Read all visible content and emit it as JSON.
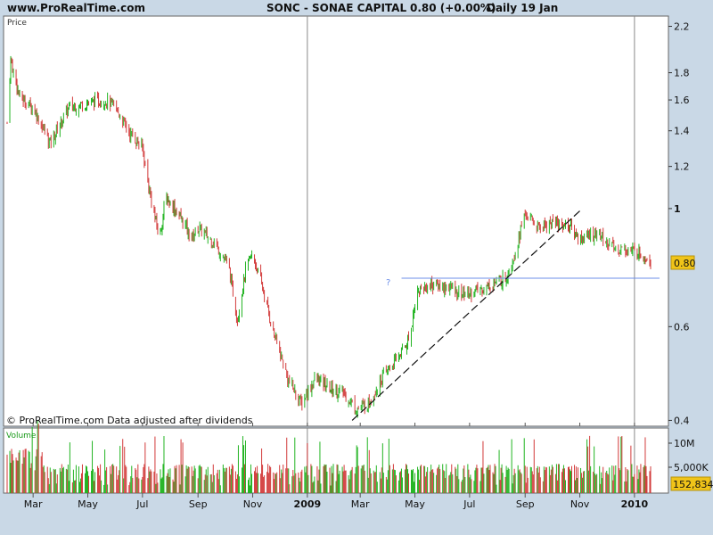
{
  "header": {
    "site": "www.ProRealTime.com",
    "title": "SONC - SONAE CAPITAL",
    "quote": "0.80 (+0.00%)",
    "period": "Daily  19 Jan"
  },
  "price_panel": {
    "label": "Price",
    "copyright": "© ProRealTime.com  Data adjusted after dividends",
    "last_price_badge": "0.80",
    "annotation": "?"
  },
  "volume_panel": {
    "label": "Volume",
    "last_volume_badge": "152,834"
  },
  "colors": {
    "up": "#22b422",
    "down": "#d23a3a",
    "badge": "#f0c419",
    "support_line": "#6d8fe8",
    "trendline": "#111111"
  },
  "chart_data": [
    {
      "type": "candlestick",
      "title": "SONC - SONAE CAPITAL",
      "ylabel": "Price",
      "y_scale": "log",
      "ylim": [
        0.39,
        2.3
      ],
      "y_ticks": [
        "2.2",
        "1.8",
        "1.6",
        "1.4",
        "1.2",
        "1",
        "0.6",
        "0.4"
      ],
      "x_range": [
        "2008-02-01",
        "2010-01-19"
      ],
      "x_ticks": [
        {
          "label": "Mar",
          "date": "2008-03-01"
        },
        {
          "label": "May",
          "date": "2008-05-01"
        },
        {
          "label": "Jul",
          "date": "2008-07-01"
        },
        {
          "label": "Sep",
          "date": "2008-09-01"
        },
        {
          "label": "Nov",
          "date": "2008-11-01"
        },
        {
          "label": "2009",
          "date": "2009-01-01",
          "bold": true
        },
        {
          "label": "Mar",
          "date": "2009-03-01"
        },
        {
          "label": "May",
          "date": "2009-05-01"
        },
        {
          "label": "Jul",
          "date": "2009-07-01"
        },
        {
          "label": "Sep",
          "date": "2009-09-01"
        },
        {
          "label": "Nov",
          "date": "2009-11-01"
        },
        {
          "label": "2010",
          "date": "2010-01-01",
          "bold": true
        }
      ],
      "price_path": [
        [
          "2008-02-01",
          1.45
        ],
        [
          "2008-02-05",
          1.9
        ],
        [
          "2008-02-15",
          1.62
        ],
        [
          "2008-03-01",
          1.55
        ],
        [
          "2008-03-20",
          1.33
        ],
        [
          "2008-04-10",
          1.55
        ],
        [
          "2008-05-01",
          1.58
        ],
        [
          "2008-05-20",
          1.6
        ],
        [
          "2008-06-01",
          1.55
        ],
        [
          "2008-06-15",
          1.4
        ],
        [
          "2008-07-01",
          1.3
        ],
        [
          "2008-07-10",
          1.05
        ],
        [
          "2008-07-20",
          0.88
        ],
        [
          "2008-07-27",
          1.05
        ],
        [
          "2008-08-10",
          0.98
        ],
        [
          "2008-08-25",
          0.88
        ],
        [
          "2008-09-01",
          0.92
        ],
        [
          "2008-09-20",
          0.86
        ],
        [
          "2008-10-05",
          0.78
        ],
        [
          "2008-10-15",
          0.62
        ],
        [
          "2008-10-25",
          0.78
        ],
        [
          "2008-11-01",
          0.82
        ],
        [
          "2008-11-10",
          0.73
        ],
        [
          "2008-11-25",
          0.58
        ],
        [
          "2008-12-10",
          0.48
        ],
        [
          "2008-12-25",
          0.43
        ],
        [
          "2009-01-10",
          0.48
        ],
        [
          "2009-01-25",
          0.46
        ],
        [
          "2009-02-10",
          0.45
        ],
        [
          "2009-02-25",
          0.42
        ],
        [
          "2009-03-10",
          0.43
        ],
        [
          "2009-03-25",
          0.48
        ],
        [
          "2009-04-10",
          0.52
        ],
        [
          "2009-04-25",
          0.57
        ],
        [
          "2009-05-03",
          0.7
        ],
        [
          "2009-05-20",
          0.72
        ],
        [
          "2009-06-10",
          0.71
        ],
        [
          "2009-06-25",
          0.69
        ],
        [
          "2009-07-10",
          0.7
        ],
        [
          "2009-07-25",
          0.72
        ],
        [
          "2009-08-10",
          0.74
        ],
        [
          "2009-08-20",
          0.82
        ],
        [
          "2009-09-01",
          0.98
        ],
        [
          "2009-09-15",
          0.92
        ],
        [
          "2009-10-01",
          0.94
        ],
        [
          "2009-10-20",
          0.93
        ],
        [
          "2009-11-01",
          0.88
        ],
        [
          "2009-11-20",
          0.9
        ],
        [
          "2009-12-10",
          0.84
        ],
        [
          "2010-01-05",
          0.83
        ],
        [
          "2010-01-19",
          0.8
        ]
      ],
      "last_price": 0.8,
      "support_line": {
        "price": 0.74,
        "from": "2009-05-01",
        "to": "2010-01-19"
      },
      "trendline": {
        "start": [
          "2009-02-20",
          0.4
        ],
        "end": [
          "2009-11-01",
          0.99
        ]
      }
    },
    {
      "type": "bar",
      "ylabel": "Volume",
      "y_ticks": [
        "10M",
        "5,000K"
      ],
      "last_volume": 152834
    }
  ]
}
